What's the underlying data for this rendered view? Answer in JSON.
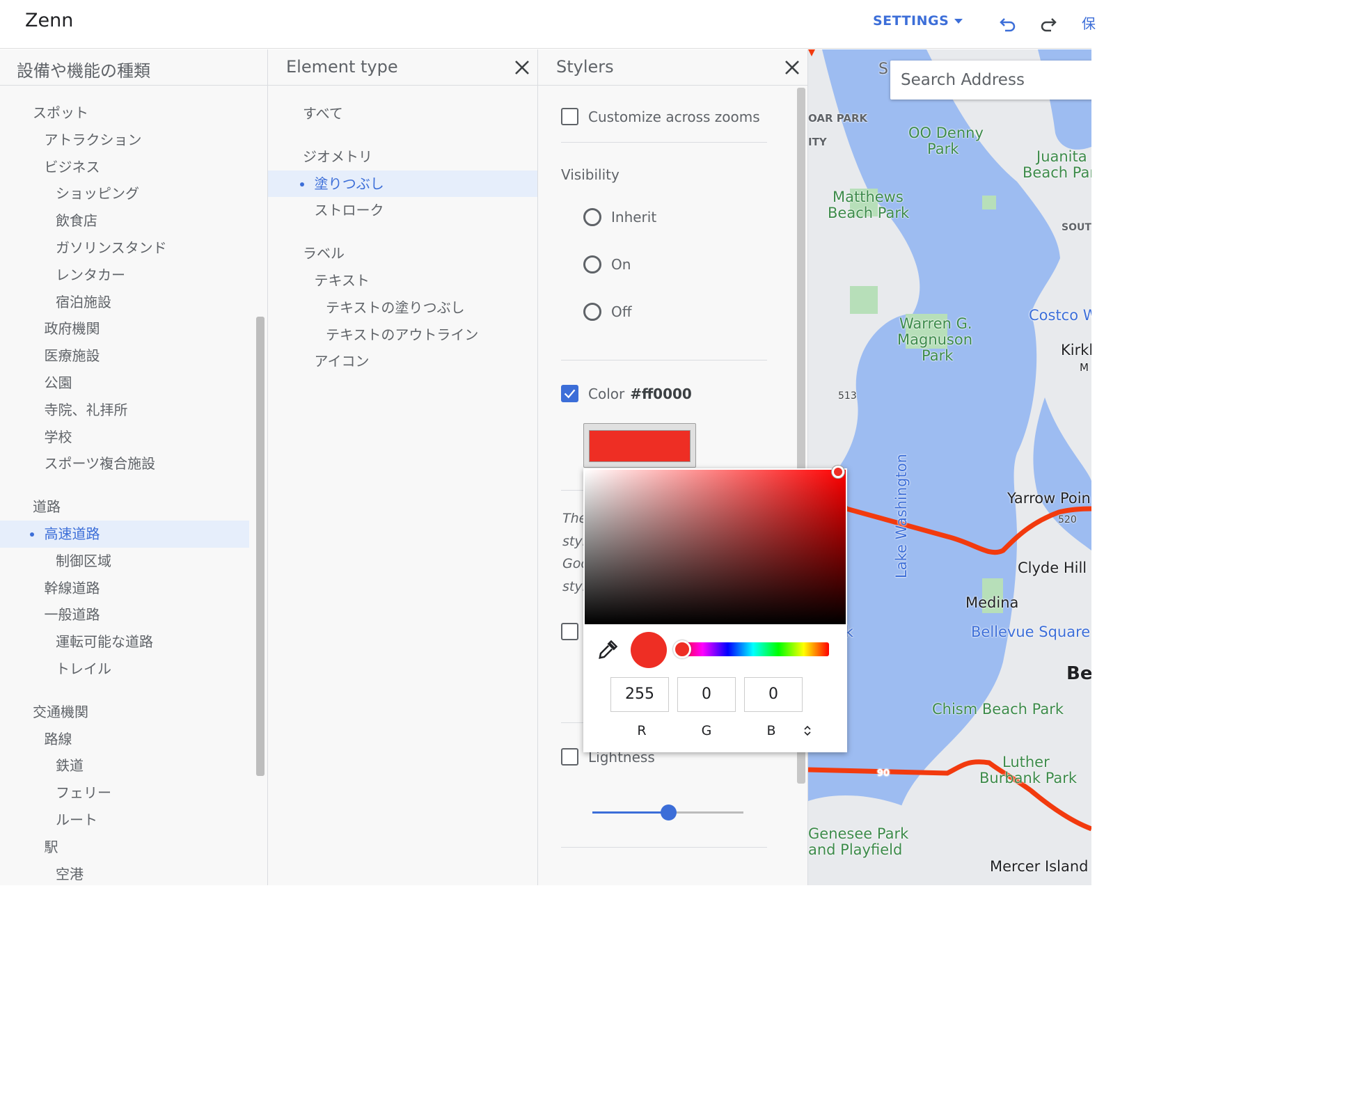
{
  "header": {
    "app_title": "Zenn",
    "settings_label": "SETTINGS",
    "cut_text": "保"
  },
  "panel1": {
    "title": "設備や機能の種類",
    "items": [
      {
        "label": "スポット",
        "level": 0
      },
      {
        "label": "アトラクション",
        "level": 1
      },
      {
        "label": "ビジネス",
        "level": 1
      },
      {
        "label": "ショッピング",
        "level": 2
      },
      {
        "label": "飲食店",
        "level": 2
      },
      {
        "label": "ガソリンスタンド",
        "level": 2
      },
      {
        "label": "レンタカー",
        "level": 2
      },
      {
        "label": "宿泊施設",
        "level": 2
      },
      {
        "label": "政府機関",
        "level": 1
      },
      {
        "label": "医療施設",
        "level": 1
      },
      {
        "label": "公園",
        "level": 1
      },
      {
        "label": "寺院、礼拝所",
        "level": 1
      },
      {
        "label": "学校",
        "level": 1
      },
      {
        "label": "スポーツ複合施設",
        "level": 1
      },
      {
        "label": "道路",
        "level": 0,
        "gap": true
      },
      {
        "label": "高速道路",
        "level": 1,
        "selected": true
      },
      {
        "label": "制御区域",
        "level": 2
      },
      {
        "label": "幹線道路",
        "level": 1
      },
      {
        "label": "一般道路",
        "level": 1
      },
      {
        "label": "運転可能な道路",
        "level": 2
      },
      {
        "label": "トレイル",
        "level": 2
      },
      {
        "label": "交通機関",
        "level": 0,
        "gap": true
      },
      {
        "label": "路線",
        "level": 1
      },
      {
        "label": "鉄道",
        "level": 2
      },
      {
        "label": "フェリー",
        "level": 2
      },
      {
        "label": "ルート",
        "level": 2
      },
      {
        "label": "駅",
        "level": 1
      },
      {
        "label": "空港",
        "level": 2
      }
    ]
  },
  "panel2": {
    "title": "Element type",
    "items": [
      {
        "label": "すべて",
        "level": 0
      },
      {
        "label": "ジオメトリ",
        "level": 0,
        "gap": true
      },
      {
        "label": "塗りつぶし",
        "level": 1,
        "selected": true
      },
      {
        "label": "ストローク",
        "level": 1
      },
      {
        "label": "ラベル",
        "level": 0,
        "gap": true
      },
      {
        "label": "テキスト",
        "level": 1
      },
      {
        "label": "テキストの塗りつぶし",
        "level": 2
      },
      {
        "label": "テキストのアウトライン",
        "level": 2
      },
      {
        "label": "アイコン",
        "level": 1
      }
    ]
  },
  "panel3": {
    "title": "Stylers",
    "customize_label": "Customize across zooms",
    "visibility_label": "Visibility",
    "visibility_options": [
      "Inherit",
      "On",
      "Off"
    ],
    "color_label": "Color",
    "color_value": "#ff0000",
    "italic_lines": [
      "The",
      "styl",
      "Goo",
      "styl"
    ],
    "lightness_label": "Lightness",
    "lightness_value": 0.5
  },
  "color_picker": {
    "r": "255",
    "g": "0",
    "b": "0",
    "r_label": "R",
    "g_label": "G",
    "b_label": "B"
  },
  "map": {
    "search_placeholder": "Search Address",
    "labels": [
      "S",
      "OAR PARK",
      "ITY",
      "OO Denny",
      "Park",
      "Juanita",
      "Beach Par",
      "Matthews",
      "Beach Park",
      "SOUT",
      "Warren G.",
      "Magnuson",
      "Park",
      "Costco W",
      "Kirkl",
      "M",
      "513",
      "Yarrow Poin",
      "520",
      "Clyde Hill",
      "Medina",
      "Lake Washington",
      "a Park",
      "Bellevue Square",
      "Be",
      "Chism Beach Park",
      "90",
      "Luther",
      "Burbank Park",
      "Genesee Park",
      "and Playfield",
      "Mercer Island"
    ]
  },
  "colors": {
    "accent": "#3c6ed8",
    "selected_bg": "#e6eefb",
    "swatch": "#ee2e24",
    "water": "#9dbcf1",
    "land": "#e8eaed",
    "park": "#b7dfb9",
    "highway": "#f23a0e"
  }
}
